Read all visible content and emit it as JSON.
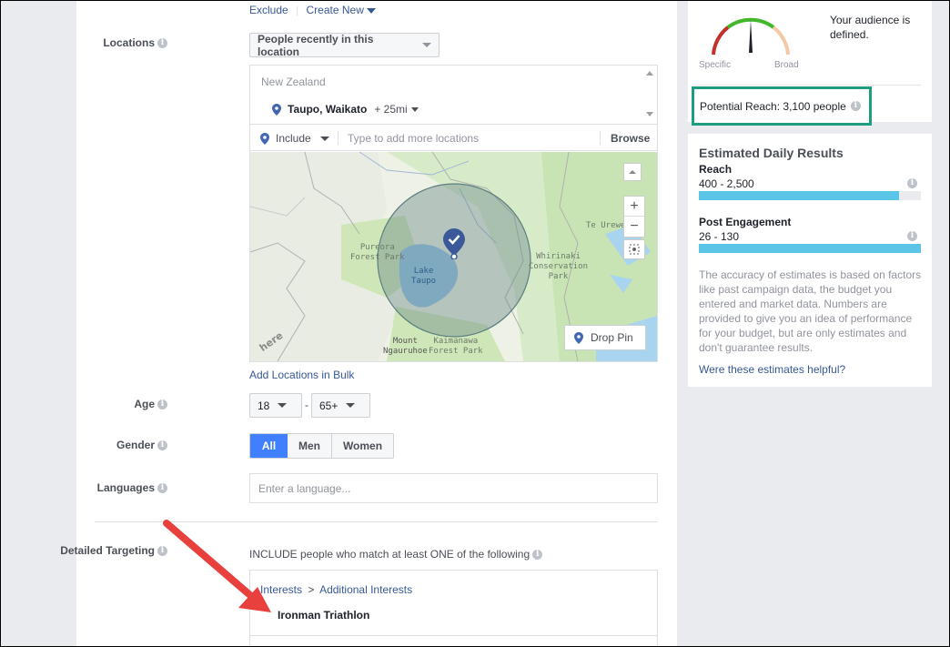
{
  "top_links": {
    "exclude": "Exclude",
    "create_new": "Create New"
  },
  "locations": {
    "label": "Locations",
    "dropdown": "People recently in this location",
    "country": "New Zealand",
    "place": "Taupo, Waikato",
    "radius": "+ 25mi",
    "include": "Include",
    "placeholder": "Type to add more locations",
    "browse": "Browse",
    "add_bulk": "Add Locations in Bulk"
  },
  "map": {
    "labels": {
      "pureora": "Pureora\nForest Park",
      "lake": "Lake\nTaupo",
      "whirinaki": "Whirinaki\nConservation\nPark",
      "te_urewera": "Te Urewe",
      "ngauruhoe": "Mount\nNgauruhoe",
      "kaimanawa": "Kaimanawa\nForest Park",
      "brand": "here"
    },
    "drop_pin": "Drop Pin",
    "zoom_in": "+",
    "zoom_out": "−"
  },
  "age": {
    "label": "Age",
    "min": "18",
    "dash": "-",
    "max": "65+"
  },
  "gender": {
    "label": "Gender",
    "options": [
      "All",
      "Men",
      "Women"
    ],
    "selected": "All"
  },
  "languages": {
    "label": "Languages",
    "placeholder": "Enter a language..."
  },
  "detailed": {
    "label": "Detailed Targeting",
    "include_text": "INCLUDE people who match at least ONE of the following",
    "crumb1": "Interests",
    "crumb_sep": ">",
    "crumb2": "Additional Interests",
    "item": "Ironman Triathlon"
  },
  "audience": {
    "gauge_specific": "Specific",
    "gauge_broad": "Broad",
    "defined_text": "Your audience is defined.",
    "potential_reach": "Potential Reach: 3,100 people"
  },
  "estimates": {
    "title": "Estimated Daily Results",
    "reach_label": "Reach",
    "reach_value": "400 - 2,500",
    "reach_fill": 0.9,
    "engagement_label": "Post Engagement",
    "engagement_value": "26 - 130",
    "engagement_fill": 1.0,
    "disclaimer": "The accuracy of estimates is based on factors like past campaign data, the budget you entered and market data. Numbers are provided to give you an idea of performance for your budget, but are only estimates and don't guarantee results.",
    "helpful_link": "Were these estimates helpful?"
  },
  "colors": {
    "accent": "#4267b2",
    "highlight": "#1e9c7f",
    "bar": "#5bc5e8",
    "arrow": "#e8413d"
  }
}
